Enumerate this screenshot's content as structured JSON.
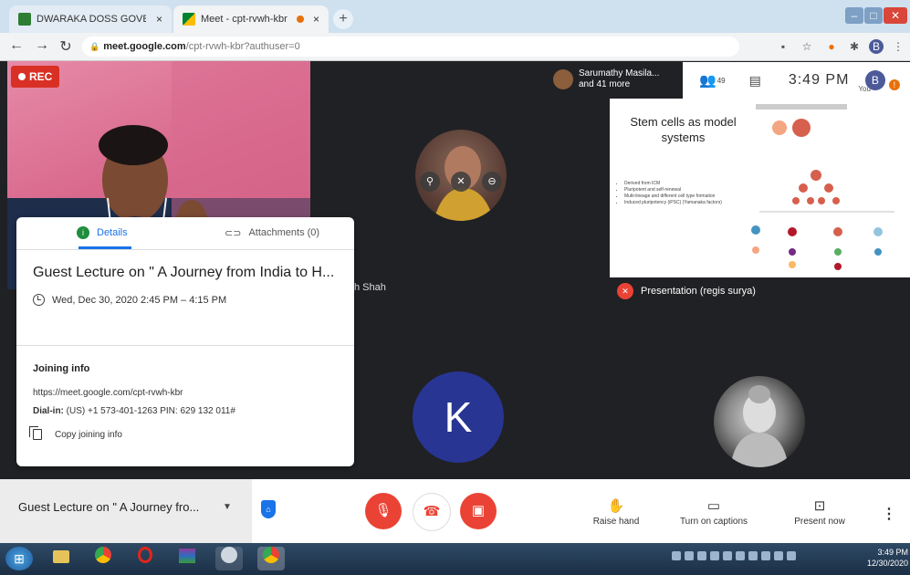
{
  "browser": {
    "tabs": [
      {
        "label": "DWARAKA DOSS GOVERDHAN",
        "close": "×"
      },
      {
        "label": "Meet - cpt-rvwh-kbr",
        "close": "×"
      }
    ],
    "new_tab": "+",
    "window_controls": [
      "–",
      "□",
      "✕"
    ],
    "url": {
      "host": "meet.google.com",
      "path": "/cpt-rvwh-kbr?authuser=0"
    },
    "profile_initial": "B"
  },
  "meet": {
    "rec_label": "REC",
    "top_participants": {
      "name": "Sarumathy Masila...",
      "more": "and 41 more"
    },
    "people_count": "49",
    "time": "3:49 PM",
    "you_label": "You",
    "you_initial": "B",
    "slide": {
      "title": "Stem cells as model systems",
      "bullets": [
        "Derived from ICM",
        "Pluripotent and self-renewal",
        "Multi-lineage and different cell type formation",
        "Induced pluripotency (iPSC) (Yamanaka factors)"
      ]
    },
    "presentation_label": "Presentation (regis surya)",
    "tile_name_suffix": "h Shah",
    "k_initial": "K"
  },
  "details_card": {
    "tab_details": "Details",
    "tab_attachments": "Attachments (0)",
    "title": "Guest Lecture on \" A Journey from India to H...",
    "datetime": "Wed, Dec 30, 2020 2:45 PM – 4:15 PM",
    "joining_heading": "Joining info",
    "joining_url": "https://meet.google.com/cpt-rvwh-kbr",
    "dialin_label": "Dial-in:",
    "dialin_value": "(US) +1 573-401-1263  PIN: 629 132 011#",
    "copy_label": "Copy joining info"
  },
  "bottom_bar": {
    "meeting_title": "Guest Lecture on \" A Journey fro...",
    "raise_hand": "Raise hand",
    "captions": "Turn on captions",
    "present": "Present now"
  },
  "taskbar": {
    "time": "3:49 PM",
    "date": "12/30/2020"
  },
  "colors": {
    "rec": "#d93025",
    "mic_off": "#ea4335",
    "k_avatar": "#283593",
    "accent": "#1a73e8"
  }
}
